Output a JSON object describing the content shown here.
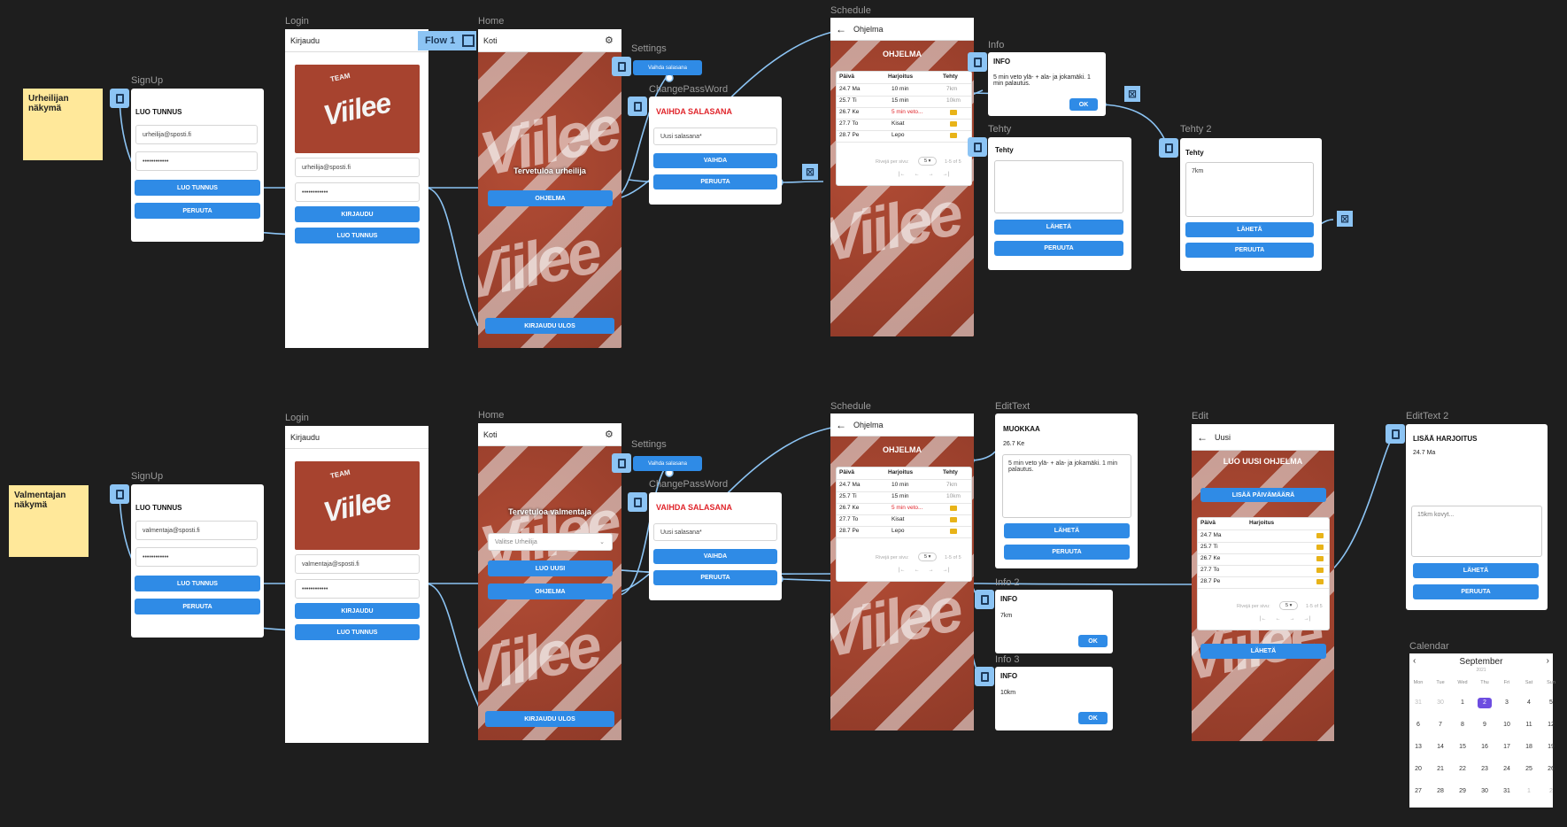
{
  "sticky": {
    "top": "Urheilijan näkymä",
    "bottom": "Valmentajan näkymä"
  },
  "flow_badge": "Flow 1",
  "frame_labels": {
    "signup": "SignUp",
    "login": "Login",
    "home": "Home",
    "settings": "Settings",
    "change_password": "ChangePassWord",
    "schedule": "Schedule",
    "info": "Info",
    "tehty": "Tehty",
    "tehty2": "Tehty 2",
    "edittext": "EditText",
    "edit": "Edit",
    "edittext2": "EditText 2",
    "info2": "Info 2",
    "info3": "Info 3",
    "calendar": "Calendar"
  },
  "signup_top": {
    "title": "LUO TUNNUS",
    "email": "urheilija@sposti.fi",
    "password": "••••••••••••",
    "create": "LUO TUNNUS",
    "cancel": "PERUUTA"
  },
  "signup_bottom": {
    "title": "LUO TUNNUS",
    "email": "valmentaja@sposti.fi",
    "password": "••••••••••••",
    "create": "LUO TUNNUS",
    "cancel": "PERUUTA"
  },
  "login_top": {
    "header": "Kirjaudu",
    "logo_small": "TEAM",
    "logo_big": "Viilee",
    "email": "urheilija@sposti.fi",
    "password": "••••••••••••",
    "login": "KIRJAUDU",
    "create": "LUO TUNNUS"
  },
  "login_bottom": {
    "header": "Kirjaudu",
    "logo_small": "TEAM",
    "logo_big": "Viilee",
    "email": "valmentaja@sposti.fi",
    "password": "••••••••••••",
    "login": "KIRJAUDU",
    "create": "LUO TUNNUS"
  },
  "home_top": {
    "header": "Koti",
    "welcome": "Tervetuloa urheilija",
    "program": "OHJELMA",
    "logout": "KIRJAUDU ULOS",
    "bg_text": "Viilee"
  },
  "home_bottom": {
    "header": "Koti",
    "welcome": "Tervetuloa valmentaja",
    "select": "Valitse Urheilija",
    "new": "LUO UUSI",
    "program": "OHJELMA",
    "logout": "KIRJAUDU ULOS",
    "bg_text": "Viilee"
  },
  "settings": {
    "change_pw": "Vaihda salasana"
  },
  "change_pw": {
    "title": "VAIHDA SALASANA",
    "placeholder": "Uusi salasana*",
    "change": "VAIHDA",
    "cancel": "PERUUTA"
  },
  "schedule": {
    "header": "Ohjelma",
    "banner": "OHJELMA",
    "columns": [
      "Päivä",
      "Harjoitus",
      "Tehty"
    ],
    "rows_top": [
      {
        "day": "24.7 Ma",
        "ex": "10 min",
        "done": "7km",
        "red": false
      },
      {
        "day": "25.7 Ti",
        "ex": "15 min",
        "done": "10km",
        "red": false
      },
      {
        "day": "26.7 Ke",
        "ex": "5 min veto...",
        "done": "",
        "red": true
      },
      {
        "day": "27.7 To",
        "ex": "Kisat",
        "done": "",
        "red": false
      },
      {
        "day": "28.7 Pe",
        "ex": "Lepo",
        "done": "",
        "red": false
      }
    ],
    "rows_bottom": [
      {
        "day": "24.7 Ma",
        "ex": "10 min",
        "done": "7km",
        "red": false
      },
      {
        "day": "25.7 Ti",
        "ex": "15 min",
        "done": "10km",
        "red": false
      },
      {
        "day": "26.7 Ke",
        "ex": "5 min veto...",
        "done": "",
        "red": true
      },
      {
        "day": "27.7 To",
        "ex": "Kisat",
        "done": "",
        "red": false
      },
      {
        "day": "28.7 Pe",
        "ex": "Lepo",
        "done": "",
        "red": false
      }
    ],
    "rows_per_page": "Rivejä per sivu:",
    "per_page_value": "5",
    "range": "1-5 of 5",
    "pager": [
      "|←",
      "←",
      "→",
      "→|"
    ]
  },
  "info": {
    "title": "INFO",
    "text": "5 min veto ylä- + ala- ja jokamäki. 1 min palautus.",
    "ok": "OK"
  },
  "tehty": {
    "title": "Tehty",
    "value": "",
    "send": "LÄHETÄ",
    "cancel": "PERUUTA"
  },
  "tehty2": {
    "title": "Tehty",
    "value": "7km",
    "send": "LÄHETÄ",
    "cancel": "PERUUTA"
  },
  "edittext": {
    "title": "MUOKKAA",
    "date": "26.7 Ke",
    "text": "5 min veto ylä- + ala- ja jokamäki. 1 min palautus.",
    "send": "LÄHETÄ",
    "cancel": "PERUUTA"
  },
  "info2": {
    "title": "INFO",
    "text": "7km",
    "ok": "OK"
  },
  "info3": {
    "title": "INFO",
    "text": "10km",
    "ok": "OK"
  },
  "edit": {
    "header": "Uusi",
    "banner": "LUO UUSI OHJELMA",
    "add_date": "LISÄÄ PÄIVÄMÄÄRÄ",
    "columns": [
      "Päivä",
      "Harjoitus"
    ],
    "days": [
      "24.7 Ma",
      "25.7 Ti",
      "26.7 Ke",
      "27.7 To",
      "28.7 Pe"
    ],
    "rows_per_page": "Rivejä per sivu:",
    "per_page_value": "5",
    "range": "1-5 of 5",
    "pager": [
      "|←",
      "←",
      "→",
      "→|"
    ],
    "send": "LÄHETÄ"
  },
  "edittext2": {
    "title": "LISÄÄ HARJOITUS",
    "date": "24.7 Ma",
    "placeholder": "15km kovyt...",
    "send": "LÄHETÄ",
    "cancel": "PERUUTA"
  },
  "calendar": {
    "month": "September",
    "year": "2021",
    "weekdays": [
      "Mon",
      "Tue",
      "Wed",
      "Thu",
      "Fri",
      "Sat",
      "Sun"
    ],
    "weeks": [
      [
        "31",
        "30",
        "1",
        "2",
        "3",
        "4",
        "5"
      ],
      [
        "6",
        "7",
        "8",
        "9",
        "10",
        "11",
        "12"
      ],
      [
        "13",
        "14",
        "15",
        "16",
        "17",
        "18",
        "19"
      ],
      [
        "20",
        "21",
        "22",
        "23",
        "24",
        "25",
        "26"
      ],
      [
        "27",
        "28",
        "29",
        "30",
        "31",
        "1",
        "2"
      ]
    ],
    "selected": "2"
  },
  "colors": {
    "accent": "#2f8be6",
    "wire": "#8cc4f4",
    "sticky": "#ffe89a",
    "track": "#a7432f",
    "danger": "#e0252b"
  }
}
